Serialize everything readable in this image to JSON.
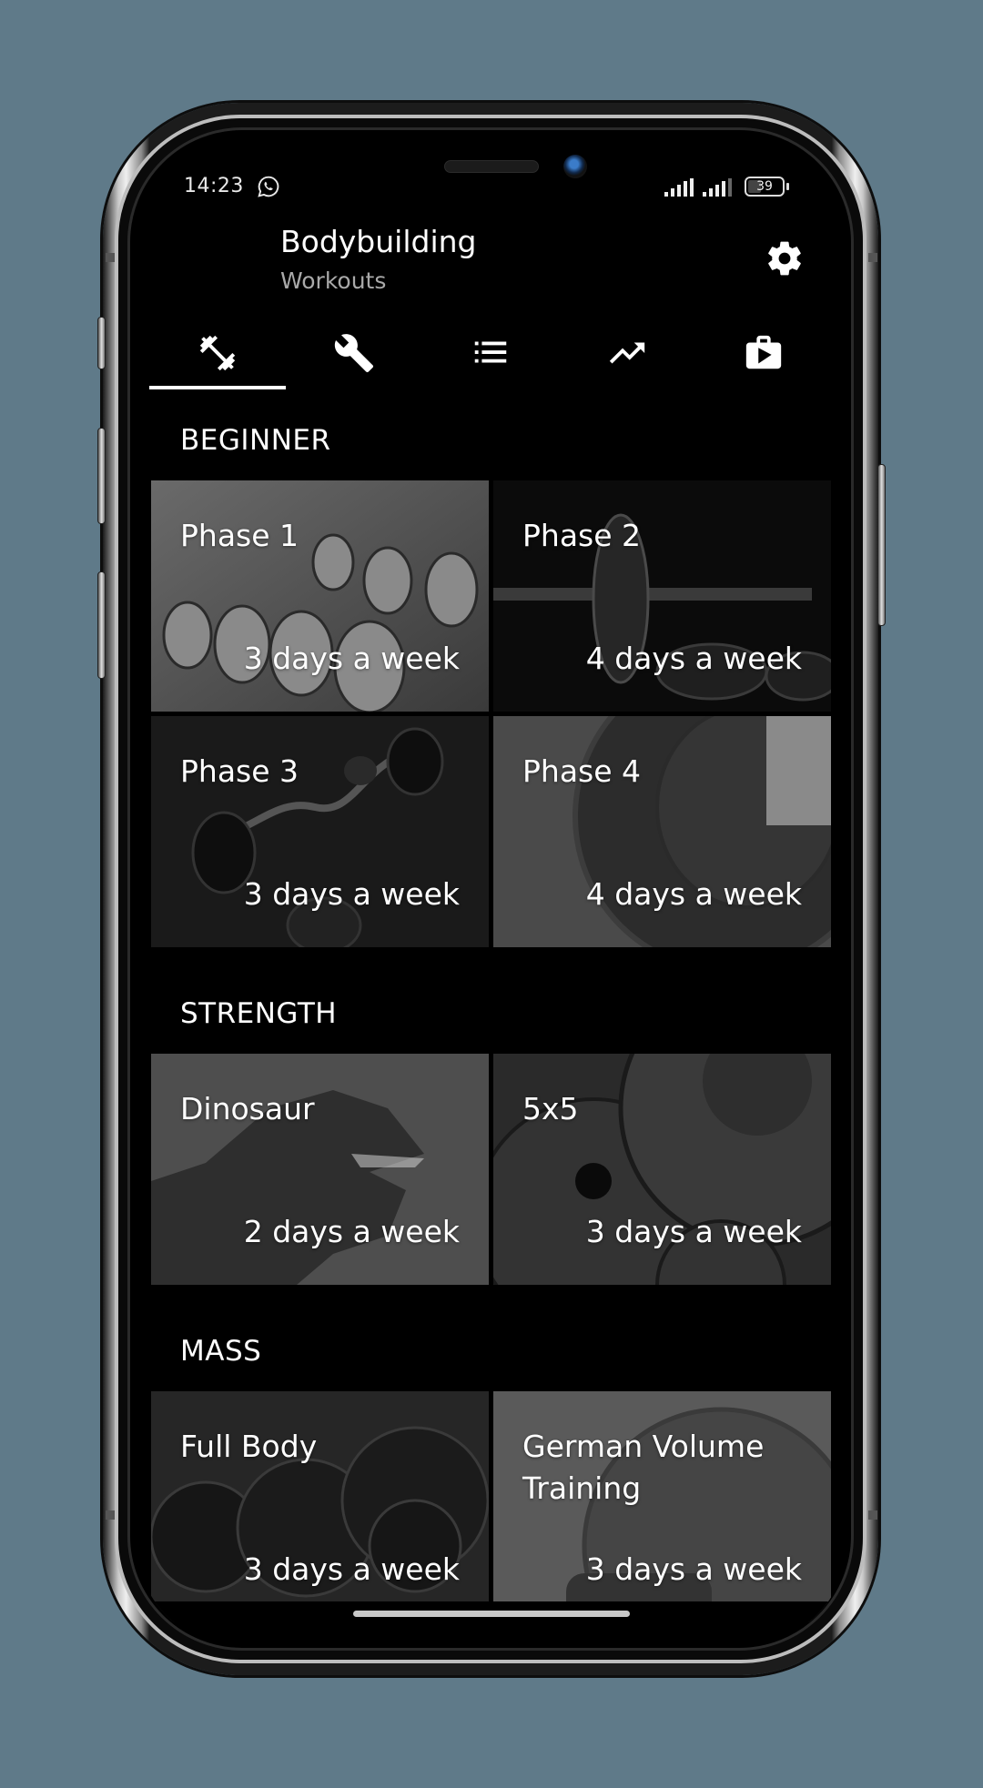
{
  "status_bar": {
    "time": "14:23",
    "notification_icon": "whatsapp-icon",
    "battery": "39",
    "battery_level_percent": 39
  },
  "appbar": {
    "title": "Bodybuilding",
    "subtitle": "Workouts",
    "settings_icon": "gear-icon"
  },
  "tabs": [
    {
      "icon": "dumbbell-icon",
      "active": true
    },
    {
      "icon": "wrench-icon",
      "active": false
    },
    {
      "icon": "list-icon",
      "active": false
    },
    {
      "icon": "trending-up-icon",
      "active": false
    },
    {
      "icon": "store-bag-icon",
      "active": false
    }
  ],
  "sections": [
    {
      "title": "BEGINNER",
      "cards": [
        {
          "name": "Phase 1",
          "frequency": "3 days a week"
        },
        {
          "name": "Phase 2",
          "frequency": "4 days a week"
        },
        {
          "name": "Phase 3",
          "frequency": "3 days a week"
        },
        {
          "name": "Phase 4",
          "frequency": "4 days a week"
        }
      ]
    },
    {
      "title": "STRENGTH",
      "cards": [
        {
          "name": "Dinosaur",
          "frequency": "2 days a week"
        },
        {
          "name": "5x5",
          "frequency": "3 days a week"
        }
      ]
    },
    {
      "title": "MASS",
      "cards": [
        {
          "name": "Full Body",
          "frequency": "3 days a week"
        },
        {
          "name": "German Volume Training",
          "frequency": "3 days a week"
        }
      ]
    }
  ],
  "colors": {
    "background": "#5f7a89",
    "screen": "#000000",
    "text_primary": "#ffffff",
    "text_secondary": "#a9a9a9"
  }
}
